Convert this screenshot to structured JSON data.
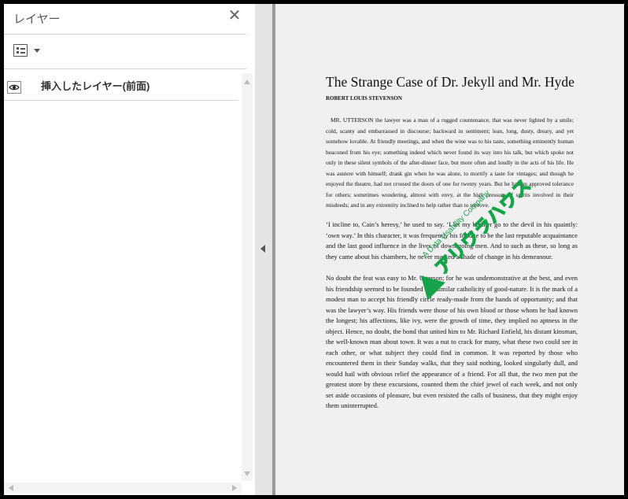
{
  "panel": {
    "title": "レイヤー",
    "close_icon": "close-icon",
    "options_icon": "list-options-icon",
    "layers": [
      {
        "label": "挿入したレイヤー(前面)",
        "visible": true
      }
    ]
  },
  "document": {
    "title": "The Strange Case of Dr. Jekyll and Mr. Hyde",
    "author": "ROBERT LOUIS STEVENSON",
    "paragraphs": [
      "MR. UTTERSON the lawyer was a man of a rugged countenance, that was never lighted by a smile; cold, scanty and embarrassed in discourse; backward in sentiment; lean, long, dusty, dreary, and yet somehow lovable. At friendly meetings, and when the wine was to his taste, something eminently human beaconed from his eye; something indeed which never found its way into his talk, but which spoke not only in these silent symbols of the after-dinner face, but more often and loudly in the acts of his life. He was austere with himself; drank gin when he was alone, to mortify a taste for vintages; and though he enjoyed the theatre, had not crossed the doors of one for twenty years. But he had an approved tolerance for others; sometimes wondering, almost with envy, at the high pressure of spirits involved in their misdeeds; and in any extremity inclined to help rather than to reprove.",
      "‘I incline to, Cain’s heresy,’ he used to say. ‘I let my brother go to the devil in his quaintly: ‘own way.’ In this character, it was frequently his fortune to be the last reputable acquaintance and the last good influence in the lives of down-going men. And to such as these, so long as they came about his chambers, he never marked a shade of change in his demeanour.",
      "No doubt the feat was easy to Mr. Utterson; for he was undemonstrative at the best, and even his friendship seemed to be founded in a similar catholicity of good-nature. It is the mark of a modest man to accept his friendly circle ready-made from the hands of opportunity; and that was the lawyer’s way. His friends were those of his own blood or those whom he had known the longest; his affections, like ivy, were the growth of time, they implied no aptness in the object. Hence, no doubt, the bond that united him to Mr. Richard Enfield, his distant kinsman, the well-known man about town. It was a nut to crack for many, what these two could see in each other, or what subject they could find in common. It was reported by those who encountered them in their Sunday walks, that they said nothing, looked singularly dull, and would hail with obvious relief the appearance of a friend. For all that, the two men put the greatest store by these excursions, counted them the chief jewel of each week, and not only set aside occasions of pleasure, but even resisted the calls of business, that they might enjoy them uninterrupted."
    ],
    "watermark": {
      "main": "アリウラハウス",
      "sub": "A Data Usability Company",
      "color": "#16a34a"
    }
  }
}
